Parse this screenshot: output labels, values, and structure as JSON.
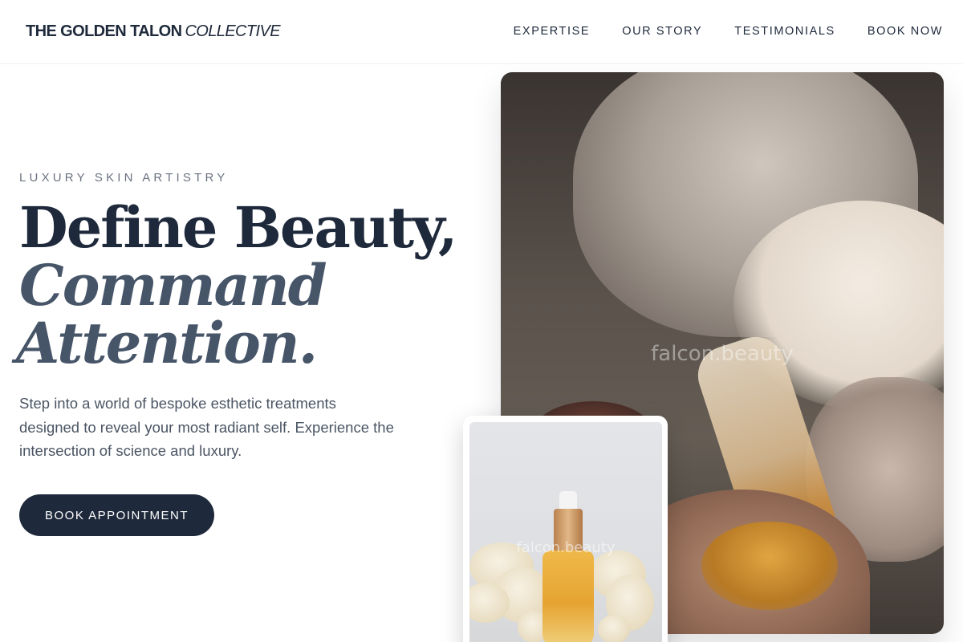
{
  "nav": {
    "brand_main": "THE GOLDEN TALON",
    "brand_accent": "COLLECTIVE",
    "links": [
      {
        "label": "EXPERTISE"
      },
      {
        "label": "OUR STORY"
      },
      {
        "label": "TESTIMONIALS"
      },
      {
        "label": "BOOK NOW"
      }
    ]
  },
  "hero": {
    "eyebrow": "LUXURY SKIN ARTISTRY",
    "headline_line1": "Define Beauty,",
    "headline_line2": "Command",
    "headline_line3": "Attention.",
    "description": "Step into a world of bespoke esthetic treatments designed to reveal your most radiant self. Experience the intersection of science and luxury.",
    "cta_label": "BOOK APPOINTMENT"
  },
  "images": {
    "main_watermark": "falcon.beauty",
    "product_watermark": "falcon.beauty"
  },
  "colors": {
    "primary": "#1e293b",
    "accent_text": "#475569",
    "muted": "#6b7280"
  }
}
